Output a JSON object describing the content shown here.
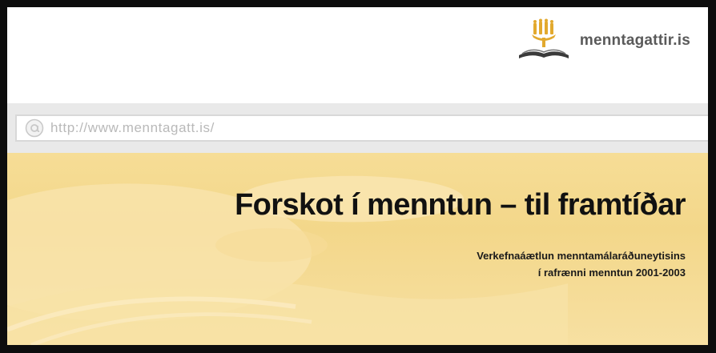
{
  "site": {
    "logo_text": "menntagattir.is",
    "logo_icon": "book-candelabra-icon"
  },
  "address_bar": {
    "url": "http://www.menntagatt.is/",
    "icon": "at-sign-icon"
  },
  "banner": {
    "headline": "Forskot í menntun – til framtíðar",
    "subtitle_line1": "Verkefnaáætlun menntamálaráðuneytisins",
    "subtitle_line2": "í rafrænni menntun 2001-2003"
  },
  "colors": {
    "frame": "#0d0d0d",
    "banner": "#f4d98e",
    "url_text": "#b9b9b9",
    "logo_gold": "#e2a92e"
  }
}
